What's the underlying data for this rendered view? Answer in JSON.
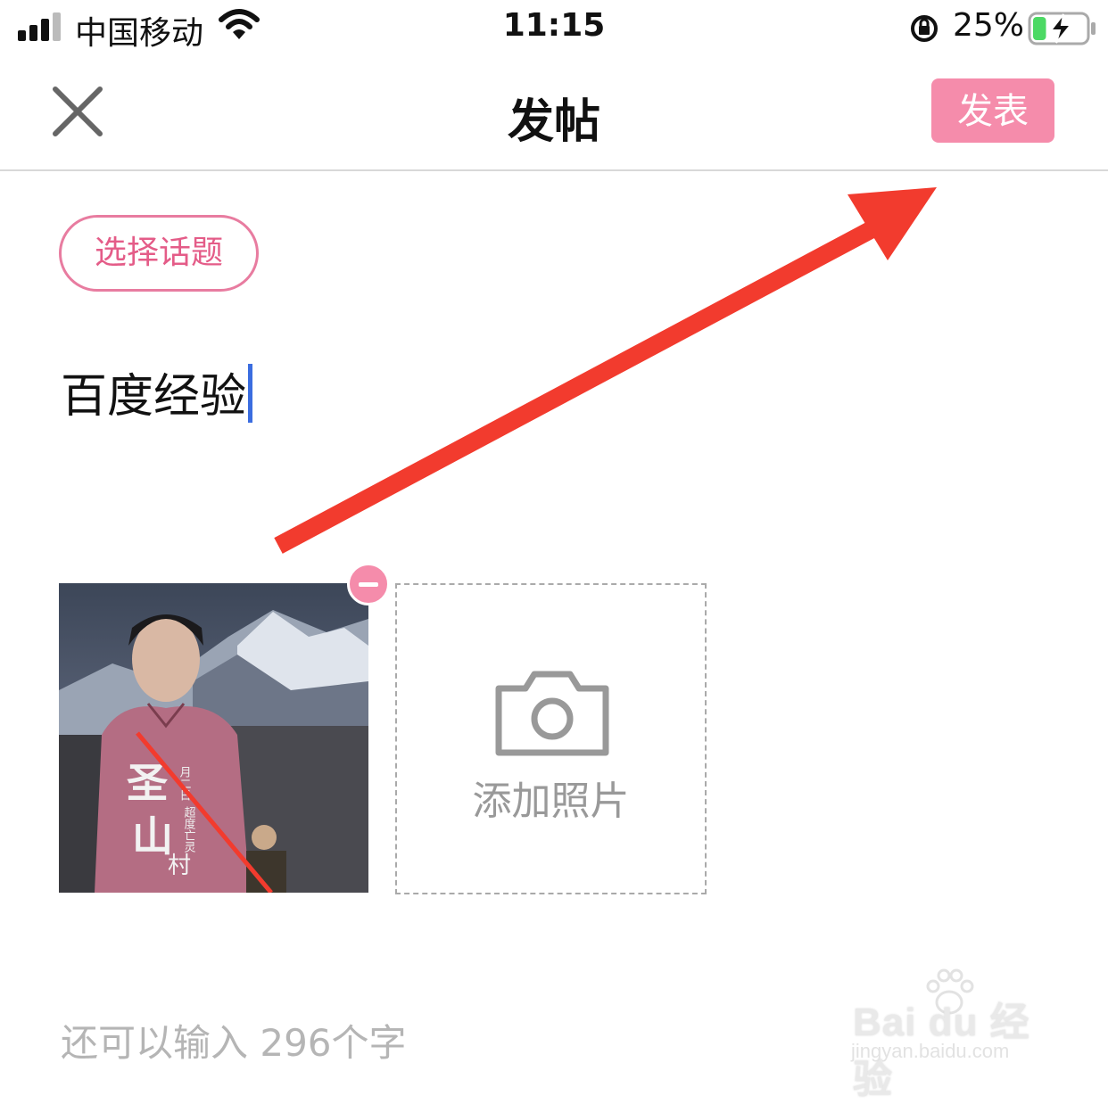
{
  "status_bar": {
    "carrier": "中国移动",
    "time": "11:15",
    "battery_percent": "25%",
    "signal_bars": 3,
    "battery_level": 0.25,
    "charging": true
  },
  "nav": {
    "title": "发帖",
    "publish_label": "发表"
  },
  "composer": {
    "topic_button_label": "选择话题",
    "text_value": "百度经验",
    "add_photo_label": "添加照片",
    "remaining_chars": "还可以输入 296个字"
  },
  "photo": {
    "caption_chars": [
      "圣",
      "山",
      "村"
    ],
    "vertical_line_1": "月二日",
    "vertical_line_2": "超度亡灵"
  },
  "watermark": {
    "brand": "Bai du 经验",
    "url": "jingyan.baidu.com"
  },
  "colors": {
    "accent_pink": "#f58cab",
    "topic_border": "#e87ca0",
    "annotation_red": "#f23b2e",
    "caret_blue": "#3b6de0"
  }
}
